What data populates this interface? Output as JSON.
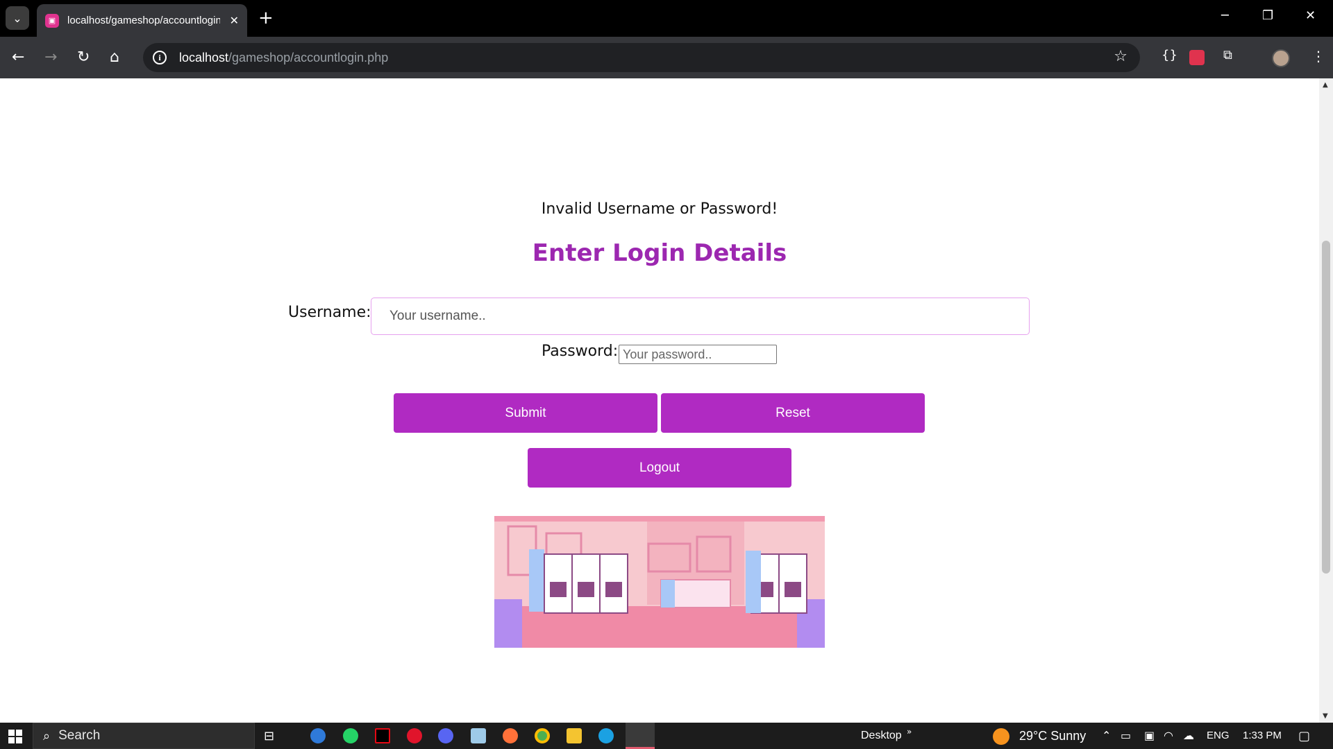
{
  "browser": {
    "tab_title": "localhost/gameshop/accountlogin.php",
    "new_tab": "+",
    "url_host": "localhost",
    "url_path": "/gameshop/accountlogin.php"
  },
  "page": {
    "error_message": "Invalid Username or Password!",
    "form_title": "Enter Login Details",
    "username_label": "Username:",
    "username_placeholder": "Your username..",
    "password_label": "Password:",
    "password_placeholder": "Your password..",
    "submit_label": "Submit",
    "reset_label": "Reset",
    "logout_label": "Logout",
    "accent_color": "#b02ac2",
    "title_color": "#9c27b0"
  },
  "taskbar": {
    "search_label": "Search",
    "desktop_label": "Desktop",
    "weather": "29°C  Sunny",
    "language": "ENG",
    "time": "1:33 PM"
  }
}
